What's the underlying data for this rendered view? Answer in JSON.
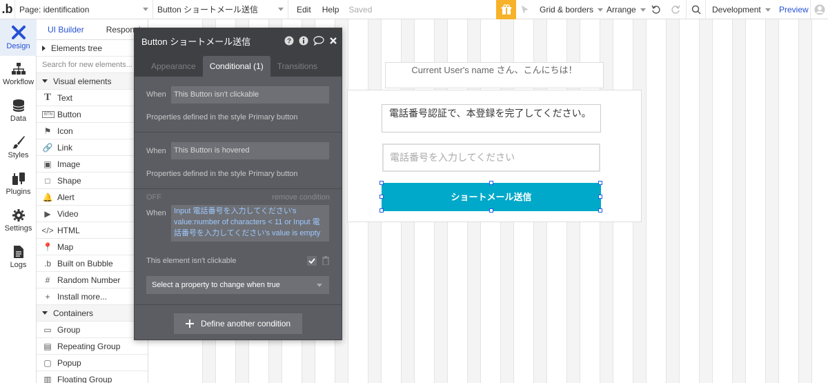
{
  "topbar": {
    "logo": ".b",
    "page_select": "Page: identification",
    "element_select": "Button ショートメール送信",
    "edit": "Edit",
    "help": "Help",
    "saved": "Saved",
    "grid_borders": "Grid & borders",
    "arrange": "Arrange",
    "environment": "Development",
    "preview": "Preview"
  },
  "leftnav": {
    "items": [
      {
        "label": "Design",
        "icon": "design-icon"
      },
      {
        "label": "Workflow",
        "icon": "workflow-icon"
      },
      {
        "label": "Data",
        "icon": "data-icon"
      },
      {
        "label": "Styles",
        "icon": "styles-icon"
      },
      {
        "label": "Plugins",
        "icon": "plugins-icon"
      },
      {
        "label": "Settings",
        "icon": "settings-icon"
      },
      {
        "label": "Logs",
        "icon": "logs-icon"
      }
    ]
  },
  "palette": {
    "tabs": [
      "UI Builder",
      "Responsive"
    ],
    "elements_tree": "Elements tree",
    "search_placeholder": "Search for new elements...",
    "visual_elements": "Visual elements",
    "visual_items": [
      {
        "label": "Text",
        "icon": "T"
      },
      {
        "label": "Button",
        "icon": "BTN"
      },
      {
        "label": "Icon",
        "icon": "⚑"
      },
      {
        "label": "Link",
        "icon": "🔗"
      },
      {
        "label": "Image",
        "icon": "▣"
      },
      {
        "label": "Shape",
        "icon": "□"
      },
      {
        "label": "Alert",
        "icon": "🔔"
      },
      {
        "label": "Video",
        "icon": "▶"
      },
      {
        "label": "HTML",
        "icon": "</>"
      },
      {
        "label": "Map",
        "icon": "📍"
      },
      {
        "label": "Built on Bubble",
        "icon": ".b"
      },
      {
        "label": "Random Number",
        "icon": "#"
      },
      {
        "label": "Install more...",
        "icon": "+"
      }
    ],
    "containers": "Containers",
    "container_items": [
      {
        "label": "Group",
        "icon": "▭"
      },
      {
        "label": "Repeating Group",
        "icon": "▤"
      },
      {
        "label": "Popup",
        "icon": "▢"
      },
      {
        "label": "Floating Group",
        "icon": "▥"
      }
    ]
  },
  "panel": {
    "title": "Button ショートメール送信",
    "tabs": [
      "Appearance",
      "Conditional (1)",
      "Transitions"
    ],
    "when_label": "When",
    "cond1": "This Button isn't clickable",
    "cond1_props": "Properties defined in the style Primary button",
    "cond2": "This Button is hovered",
    "cond2_props": "Properties defined in the style Primary button",
    "off_label": "OFF",
    "remove_condition": "remove condition",
    "expression": "Input 電話番号を入力してください's value:number of characters < 11 or Input 電話番号を入力してください's value is empty",
    "not_clickable": "This element isn't clickable",
    "property_select": "Select a property to change when true",
    "define_btn": "Define another condition"
  },
  "canvas": {
    "greeting": "Current User's name さん、こんにちは！",
    "message": "電話番号認証で、本登録を完了してください。",
    "phone_placeholder": "電話番号を入力してください",
    "send_button": "ショートメール送信"
  },
  "colors": {
    "accent": "#2451d4",
    "button": "#00a9c9",
    "gift": "#f7b22a",
    "panel": "#5b5d62"
  }
}
